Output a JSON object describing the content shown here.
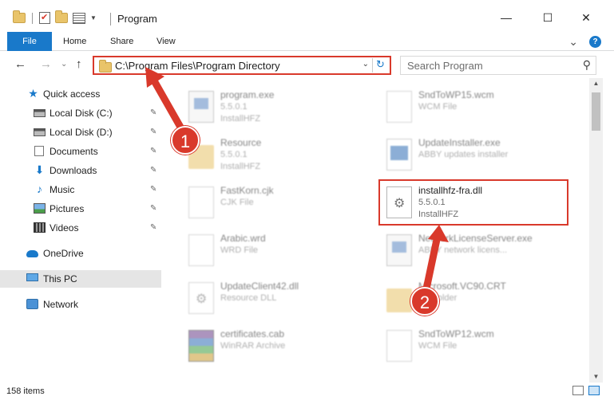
{
  "window": {
    "title": "Program",
    "minimize": "—",
    "maximize": "☐",
    "close": "✕"
  },
  "ribbon": {
    "tabs": [
      "File",
      "Home",
      "Share",
      "View"
    ],
    "collapse": "⌄",
    "help": "?"
  },
  "nav": {
    "back": "←",
    "forward": "→",
    "recent": "⌄",
    "up": "↑",
    "address": "C:\\Program Files\\Program Directory",
    "address_dropdown": "⌄",
    "refresh": "↻",
    "search_placeholder": "Search Program",
    "search_icon": "search-icon"
  },
  "sidebar": {
    "items": [
      {
        "label": "Quick access",
        "icon": "star-icon"
      },
      {
        "label": "Local Disk (C:)",
        "icon": "disk-icon",
        "pinned": true
      },
      {
        "label": "Local Disk (D:)",
        "icon": "disk-icon",
        "pinned": true
      },
      {
        "label": "Documents",
        "icon": "documents-icon",
        "pinned": true
      },
      {
        "label": "Downloads",
        "icon": "download-icon",
        "pinned": true
      },
      {
        "label": "Music",
        "icon": "music-icon",
        "pinned": true
      },
      {
        "label": "Pictures",
        "icon": "pictures-icon",
        "pinned": true
      },
      {
        "label": "Videos",
        "icon": "videos-icon",
        "pinned": true
      },
      {
        "label": "OneDrive",
        "icon": "cloud-icon"
      },
      {
        "label": "This PC",
        "icon": "computer-icon",
        "selected": true
      },
      {
        "label": "Network",
        "icon": "network-icon"
      }
    ],
    "pin_glyph": "📌"
  },
  "files": [
    {
      "name": "program.exe",
      "line2": "5.5.0.1",
      "line3": "InstallHFZ",
      "icon": "exe-icon"
    },
    {
      "name": "SndToWP15.wcm",
      "line2": "WCM File",
      "line3": "",
      "icon": "file-icon"
    },
    {
      "name": "Resource",
      "line2": "5.5.0.1",
      "line3": "InstallHFZ",
      "icon": "folder-icon"
    },
    {
      "name": "UpdateInstaller.exe",
      "line2": "ABBY updates installer",
      "line3": "",
      "icon": "installer-icon"
    },
    {
      "name": "FastKorn.cjk",
      "line2": "CJK File",
      "line3": "",
      "icon": "file-icon"
    },
    {
      "name": "installhfz-fra.dll",
      "line2": "5.5.0.1",
      "line3": "InstallHFZ",
      "icon": "dll-icon"
    },
    {
      "name": "Arabic.wrd",
      "line2": "WRD File",
      "line3": "",
      "icon": "file-icon"
    },
    {
      "name": "NetworkLicenseServer.exe",
      "line2": "ABBY network licens...",
      "line3": "",
      "icon": "exe-icon"
    },
    {
      "name": "UpdateClient42.dll",
      "line2": "Resource DLL",
      "line3": "",
      "icon": "dll-icon"
    },
    {
      "name": "Microsoft.VC90.CRT",
      "line2": "File folder",
      "line3": "",
      "icon": "folder-icon"
    },
    {
      "name": "certificates.cab",
      "line2": "WinRAR Archive",
      "line3": "",
      "icon": "archive-icon"
    },
    {
      "name": "SndToWP12.wcm",
      "line2": "WCM File",
      "line3": "",
      "icon": "file-icon"
    }
  ],
  "annotations": {
    "step1": "1",
    "step2": "2",
    "color": "#d9392b"
  },
  "status": {
    "count": "158 items"
  }
}
